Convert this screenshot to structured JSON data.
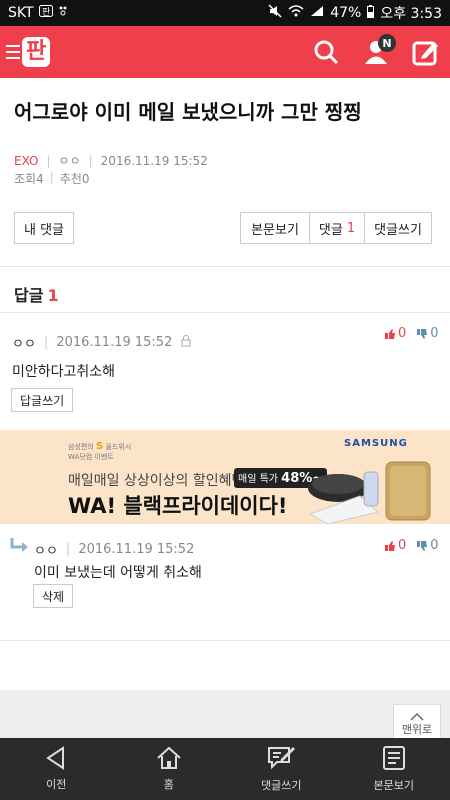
{
  "status_bar": {
    "carrier": "SKT",
    "battery": "47%",
    "time": "오후 3:53"
  },
  "app": {
    "brand": "판",
    "notification_badge": "N",
    "accent_color": "#ee3f4a"
  },
  "post": {
    "title": "어그로야 이미 메일 보냈으니까 그만 찡찡",
    "category": "EXO",
    "author": "ㅇㅇ",
    "date": "2016.11.19 15:52",
    "views_label": "조회",
    "views": "4",
    "likes_label": "추천",
    "likes": "0"
  },
  "buttons": {
    "my_comment": "내 댓글",
    "view_post": "본문보기",
    "comments": "댓글",
    "comments_count": "1",
    "write_comment": "댓글쓰기"
  },
  "replies": {
    "label": "답글",
    "count": "1"
  },
  "comments": [
    {
      "author": "ㅇㅇ",
      "date": "2016.11.19 15:52",
      "text": "미안하다고취소해",
      "action": "답글쓰기",
      "up": "0",
      "down": "0"
    },
    {
      "author": "ㅇㅇ",
      "date": "2016.11.19 15:52",
      "text": "이미 보냈는데 어떻게 취소해",
      "action": "삭제",
      "up": "0",
      "down": "0"
    }
  ],
  "ad": {
    "small_line1": "삼성편의",
    "small_s": "S",
    "small_line1b": "올드위시",
    "small_line2": "WA닷컴 이벤트",
    "line1": "매일매일 상상이상의 할인혜택",
    "badge_label": "매일 특가",
    "badge_value": "48%~",
    "line2": "WA! 블랙프라이데이다!",
    "brand": "SAMSUNG"
  },
  "to_top": "맨위로",
  "bottom_nav": [
    {
      "label": "이전",
      "icon": "back-triangle-icon"
    },
    {
      "label": "홈",
      "icon": "home-icon"
    },
    {
      "label": "댓글쓰기",
      "icon": "comment-write-icon"
    },
    {
      "label": "본문보기",
      "icon": "document-icon"
    }
  ]
}
